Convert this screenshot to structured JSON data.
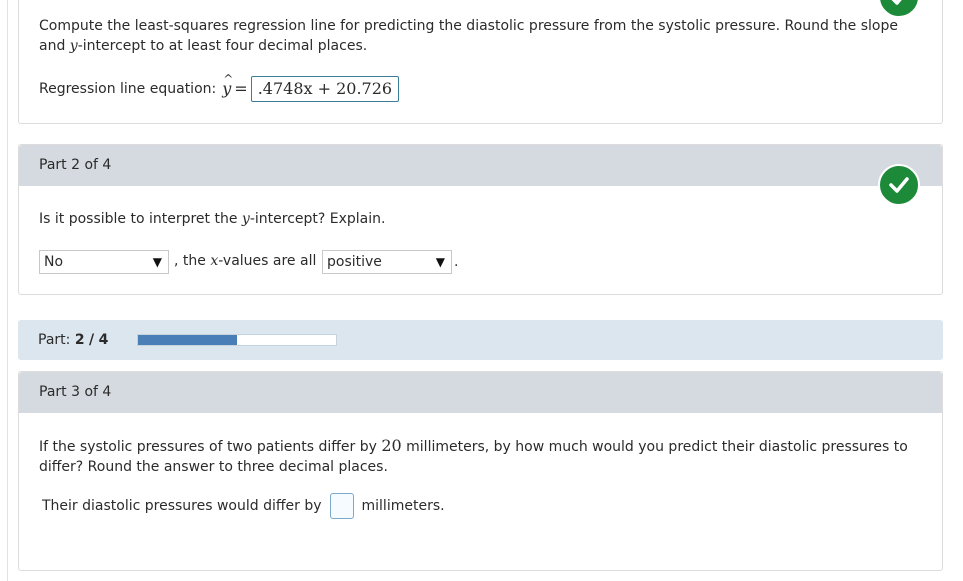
{
  "part1": {
    "instruction_a": "Compute the least-squares regression line for predicting the diastolic pressure from the systolic pressure. Round the slope",
    "instruction_b_pre": "and ",
    "instruction_b_var": "y",
    "instruction_b_post": "-intercept to at least four decimal places.",
    "equation_label": "Regression line equation:",
    "yhat": "y",
    "equals": "=",
    "answer": ".4748x + 20.726"
  },
  "part2": {
    "header": "Part 2 of 4",
    "question_pre": "Is it possible to interpret the ",
    "question_var": "y",
    "question_post": "-intercept? Explain.",
    "select1_value": "No",
    "middle_pre": ", the ",
    "middle_var": "x",
    "middle_post": "-values are all",
    "select2_value": "positive",
    "end_punct": "."
  },
  "progress": {
    "label": "Part:",
    "current": "2",
    "sep": "/",
    "total": "4",
    "fraction": 0.5,
    "bar_color": "#4a7eb6"
  },
  "part3": {
    "header": "Part 3 of 4",
    "question_pre": "If the systolic pressures of two patients differ by ",
    "question_num": "20",
    "question_post": " millimeters, by how much would you predict their diastolic pressures to",
    "question_line2": "differ? Round the answer to three decimal places.",
    "answer_pre": "Their diastolic pressures would differ by",
    "answer_value": "",
    "answer_post": "millimeters."
  },
  "colors": {
    "check_green": "#1d8a3a",
    "header_bg": "#d4dadf",
    "progress_bg": "#dce6ee"
  },
  "icons": {
    "check": "check-icon",
    "dropdown": "triangle-down-icon"
  }
}
